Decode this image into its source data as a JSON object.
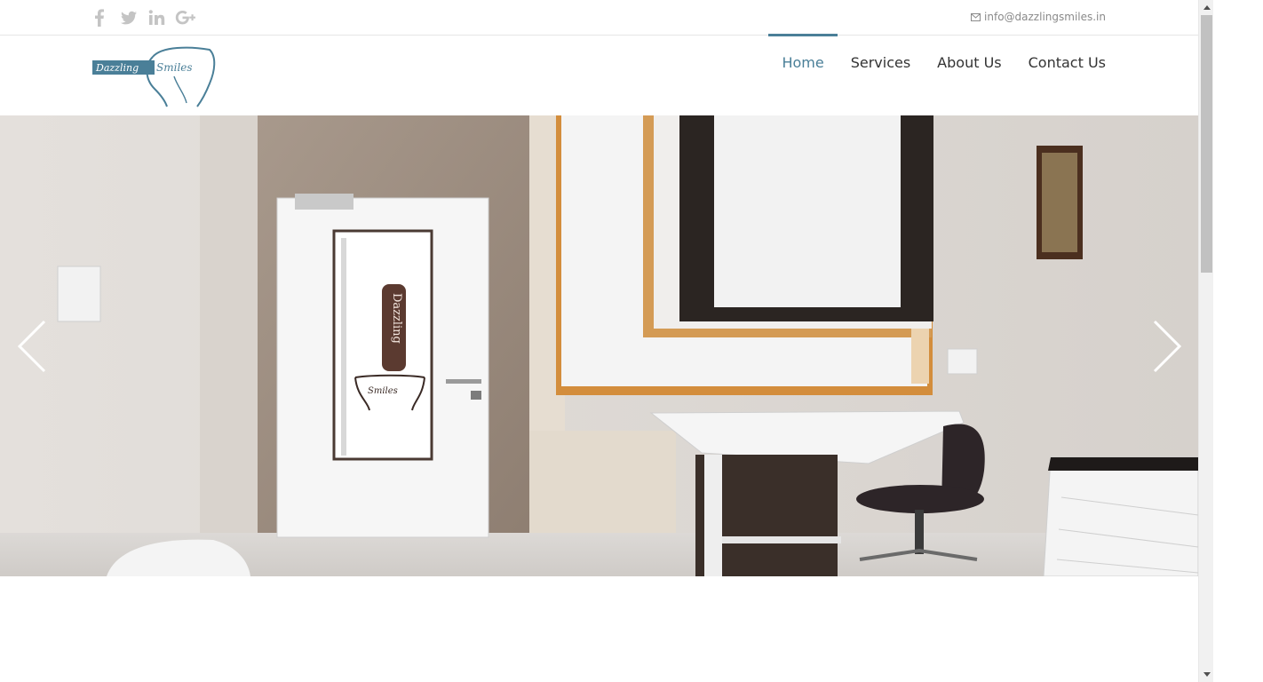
{
  "topbar": {
    "social": [
      {
        "name": "facebook-icon",
        "label": "f"
      },
      {
        "name": "twitter-icon",
        "label": "twitter"
      },
      {
        "name": "linkedin-icon",
        "label": "in"
      },
      {
        "name": "google-plus-icon",
        "label": "g+"
      }
    ],
    "email_icon": "envelope-icon",
    "email": "info@dazzlingsmiles.in"
  },
  "header": {
    "logo_word_1": "Dazzling",
    "logo_word_2": "Smiles",
    "nav": [
      {
        "label": "Home",
        "active": true
      },
      {
        "label": "Services",
        "active": false
      },
      {
        "label": "About Us",
        "active": false
      },
      {
        "label": "Contact Us",
        "active": false
      }
    ]
  },
  "hero": {
    "door_sign_text": "Dazzling",
    "door_sign_sub": "Smiles",
    "prev_icon": "chevron-left-icon",
    "next_icon": "chevron-right-icon"
  },
  "colors": {
    "accent": "#4a7f98",
    "nav_text": "#333333",
    "social_icon": "#c4c4c4",
    "email_text": "#8a8a8a"
  }
}
